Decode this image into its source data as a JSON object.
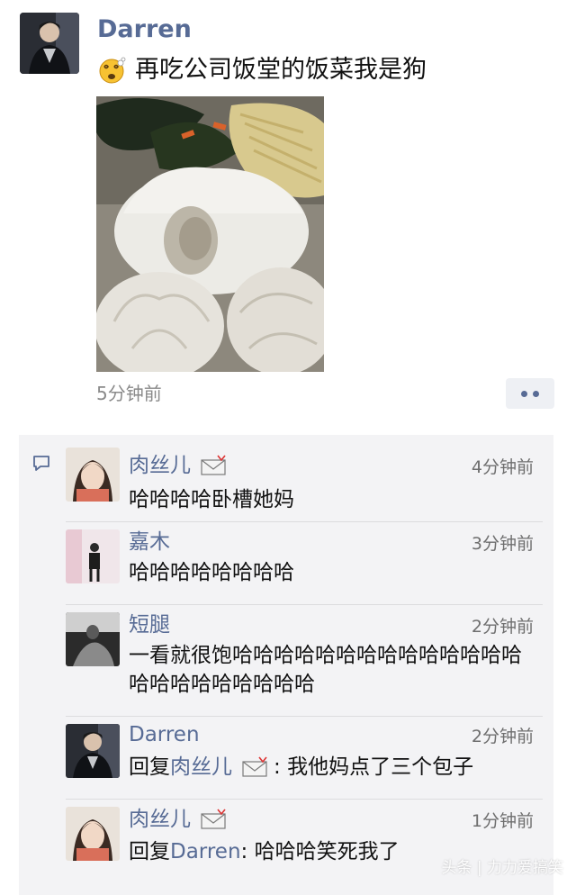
{
  "post": {
    "author": "Darren",
    "text": "再吃公司饭堂的饭菜我是狗",
    "time": "5分钟前",
    "more_icon": "more-dots-icon",
    "photo_alt": "photo of steamed buns and vegetables"
  },
  "comments": [
    {
      "name": "肉丝儿",
      "has_envelope": true,
      "time": "4分钟前",
      "text": "哈哈哈哈卧槽她妈"
    },
    {
      "name": "嘉木",
      "has_envelope": false,
      "time": "3分钟前",
      "text": "哈哈哈哈哈哈哈哈"
    },
    {
      "name": "短腿",
      "has_envelope": false,
      "time": "2分钟前",
      "text": "一看就很饱哈哈哈哈哈哈哈哈哈哈哈哈哈哈哈哈哈哈哈哈哈哈哈"
    },
    {
      "name": "Darren",
      "has_envelope": false,
      "time": "2分钟前",
      "reply_prefix": "回复",
      "reply_to": "肉丝儿",
      "reply_sep": ": ",
      "text": "我他妈点了三个包子"
    },
    {
      "name": "肉丝儿",
      "has_envelope": true,
      "time": "1分钟前",
      "reply_prefix": "回复",
      "reply_to": "Darren",
      "reply_sep": ": ",
      "text": "哈哈哈笑死我了"
    }
  ],
  "watermark": "头条 | 力力爱搞笑",
  "colors": {
    "link": "#576b95",
    "comment_bg": "#f3f3f5",
    "time": "#8a8a8a"
  }
}
